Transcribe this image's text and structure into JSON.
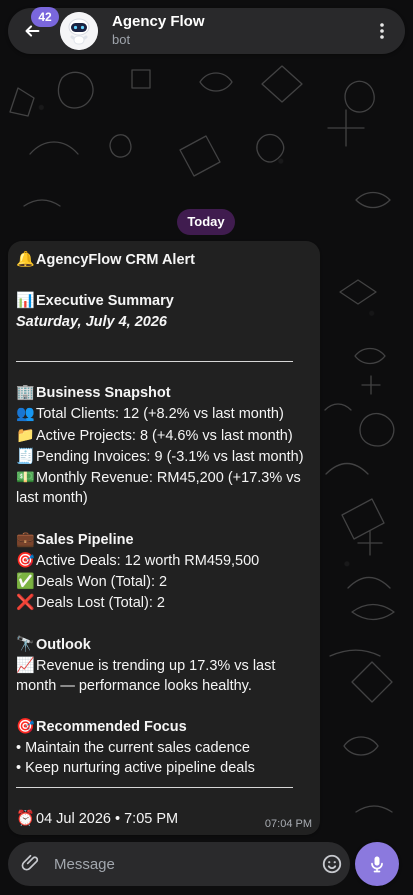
{
  "header": {
    "unread_count": "42",
    "title": "Agency Flow",
    "subtitle": "bot",
    "icons": {
      "back": "arrow-left-icon",
      "menu": "more-vertical-icon",
      "avatar": "robot-avatar"
    }
  },
  "chat": {
    "date_label": "Today",
    "message": {
      "lines": {
        "alert_icon": "🔔",
        "alert_title": "AgencyFlow CRM Alert",
        "exec_icon": "📊",
        "exec_title": "Executive Summary",
        "exec_date": "Saturday, July 4, 2026",
        "snapshot_icon": "🏢",
        "snapshot_title": "Business Snapshot",
        "clients_icon": "👥",
        "clients_text": "Total Clients: 12 (+8.2% vs last month)",
        "projects_icon": "📁",
        "projects_text": "Active Projects: 8 (+4.6% vs last month)",
        "invoices_icon": "🧾",
        "invoices_text": "Pending Invoices: 9 (-3.1% vs last month)",
        "revenue_icon": "💵",
        "revenue_text": "Monthly Revenue: RM45,200 (+17.3% vs last month)",
        "pipeline_icon": "💼",
        "pipeline_title": "Sales Pipeline",
        "deals_icon": "🎯",
        "deals_text": "Active Deals: 12 worth RM459,500",
        "won_icon": "✅",
        "won_text": "Deals Won (Total): 2",
        "lost_icon": "❌",
        "lost_text": "Deals Lost (Total): 2",
        "outlook_icon": "🔭",
        "outlook_title": "Outlook",
        "trend_icon": "📈",
        "trend_text": "Revenue is trending up 17.3% vs last month — performance looks healthy.",
        "focus_icon": "🎯",
        "focus_title": "Recommended Focus",
        "focus_1": "• Maintain the current sales cadence",
        "focus_2": "• Keep nurturing active pipeline deals",
        "footer_icon": "⏰",
        "footer_text": "04 Jul 2026 • 7:05 PM"
      },
      "time": "07:04 PM"
    }
  },
  "composer": {
    "placeholder": "Message",
    "icons": {
      "attach": "paperclip-icon",
      "emoji": "smile-icon",
      "voice": "microphone-icon"
    }
  },
  "colors": {
    "background": "#0d0d0e",
    "bubble": "#212121",
    "accent": "#8b79de",
    "badge": "#7a67dd",
    "date_pill": "#431d53"
  }
}
